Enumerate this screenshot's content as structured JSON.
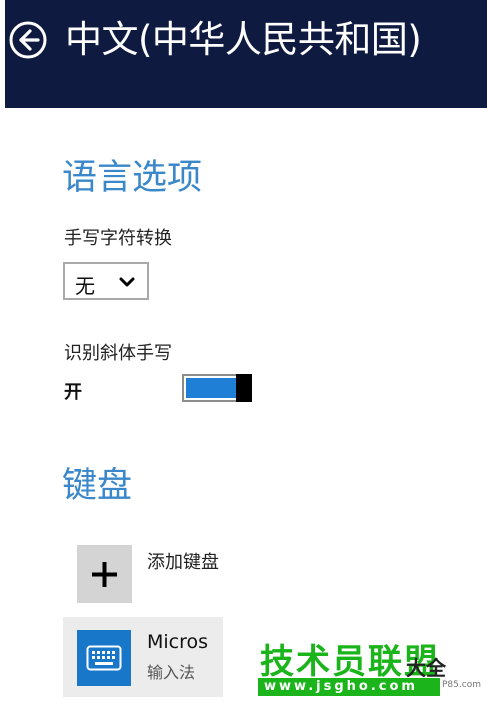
{
  "header": {
    "title": "中文(中华人民共和国)"
  },
  "language_options": {
    "title": "语言选项",
    "handwriting_conversion": {
      "label": "手写字符转换",
      "value": "无"
    },
    "italic_handwriting": {
      "label": "识别斜体手写",
      "state": "开",
      "on": true
    }
  },
  "keyboard": {
    "title": "键盘",
    "add_label": "添加键盘",
    "items": [
      {
        "name": "Micros",
        "subtitle": "输入法"
      }
    ]
  },
  "watermark": {
    "main": "技术员联盟",
    "side": "大全",
    "url": "www.jsgho.com",
    "small": "P85.com"
  },
  "colors": {
    "header_bg": "#0f1a40",
    "accent": "#3a87c9",
    "toggle_on": "#1f7fd6",
    "watermark": "#1bb51b"
  },
  "icons": [
    "back-arrow-icon",
    "chevron-down-icon",
    "plus-icon",
    "keyboard-icon"
  ]
}
